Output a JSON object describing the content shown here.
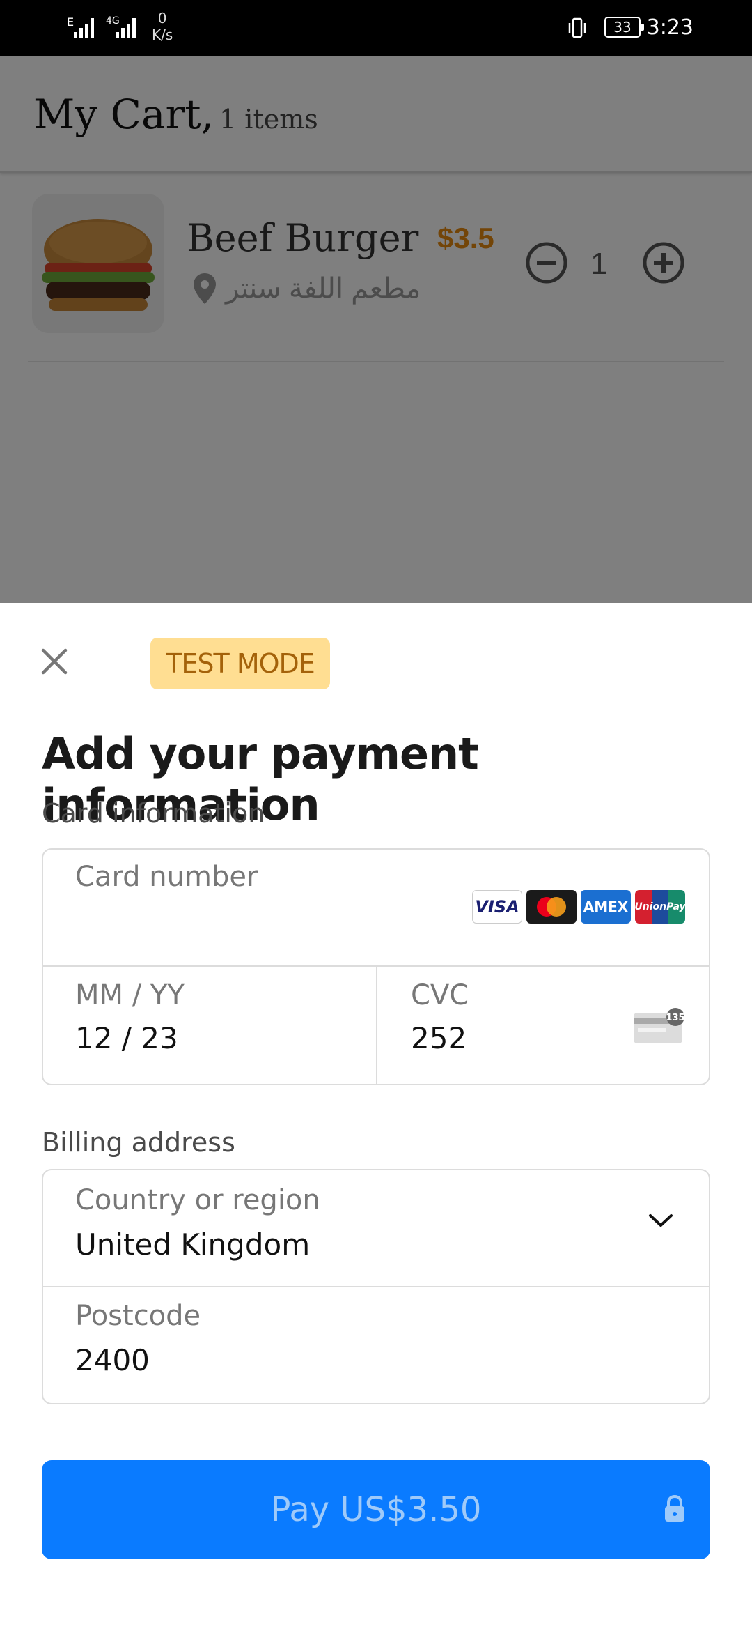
{
  "status_bar": {
    "network_1": "E",
    "network_2": "4G",
    "speed_value": "0",
    "speed_unit": "K/s",
    "battery": "33",
    "time": "3:23"
  },
  "cart": {
    "title": "My Cart,",
    "count": "1 items",
    "item": {
      "name": "Beef Burger",
      "price": "$3.5",
      "restaurant": "مطعم اللفة سنتر",
      "quantity": "1",
      "image_icon": "burger-image"
    }
  },
  "payment": {
    "test_mode_label": "TEST MODE",
    "title": "Add your payment information",
    "card_section_label": "Card information",
    "card_number_placeholder": "Card number",
    "card_brands": [
      "VISA",
      "Mastercard",
      "AMEX",
      "UnionPay"
    ],
    "expiry_label": "MM / YY",
    "expiry_value": "12 / 23",
    "cvc_label": "CVC",
    "cvc_value": "252",
    "cvc_icon_text": "135",
    "billing_section_label": "Billing address",
    "country_label": "Country or region",
    "country_value": "United Kingdom",
    "postcode_label": "Postcode",
    "postcode_value": "2400",
    "pay_button_label": "Pay US$3.50"
  },
  "colors": {
    "accent_blue": "#0a7bff",
    "test_mode_bg": "#ffde92",
    "price_orange": "#e78a10"
  }
}
